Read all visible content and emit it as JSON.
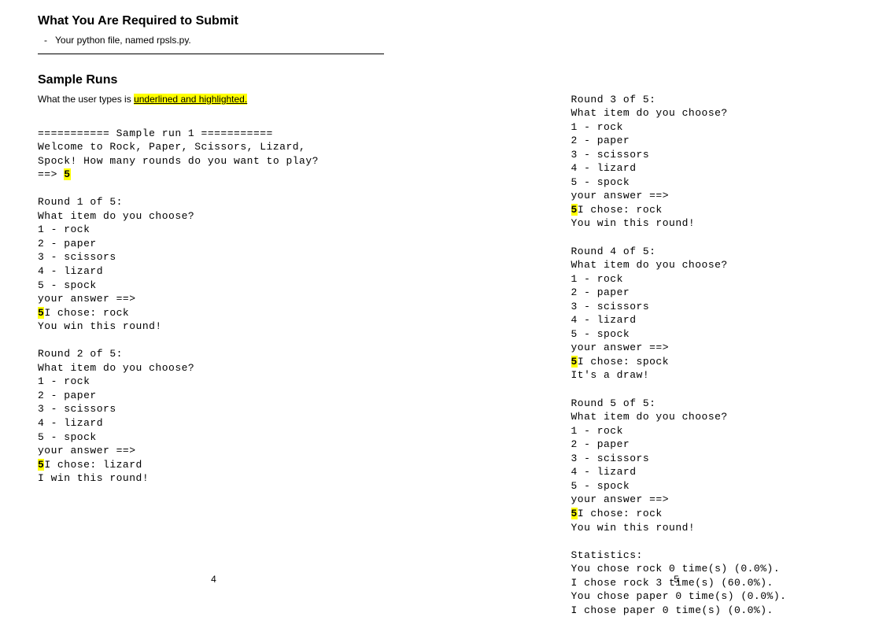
{
  "left": {
    "heading_submit": "What You Are Required to Submit",
    "bullet": "Your python file, named rpsls.py.",
    "heading_runs": "Sample Runs",
    "intro_pre": "What the user types is ",
    "intro_hl": "underlined and highlighted.",
    "run_header": "=========== Sample run 1 ===========",
    "welcome1": "Welcome to Rock, Paper, Scissors, Lizard,",
    "welcome2": "Spock! How many rounds do you want to play?",
    "prompt_top": "==> ",
    "input_top": "5",
    "round1": {
      "title": "Round 1 of 5:",
      "q": "What item do you choose?",
      "opts": [
        "1 - rock",
        "2 - paper",
        "3 - scissors",
        "4 - lizard",
        "5 - spock"
      ],
      "prompt": "your answer ==>",
      "input": "5",
      "chose": "I chose: rock",
      "result": "You win this round!"
    },
    "round2": {
      "title": "Round 2 of 5:",
      "q": "What item do you choose?",
      "opts": [
        "1 - rock",
        "2 - paper",
        "3 - scissors",
        "4 - lizard",
        "5 - spock"
      ],
      "prompt": "your answer ==>",
      "input": "5",
      "chose": "I chose: lizard",
      "result": "I win this round!"
    },
    "page_num": "4"
  },
  "right": {
    "round3": {
      "title": "Round 3 of 5:",
      "q": "What item do you choose?",
      "opts": [
        "1 - rock",
        "2 - paper",
        "3 - scissors",
        "4 - lizard",
        "5 - spock"
      ],
      "prompt": "your answer ==>",
      "input": "5",
      "chose": "I chose: rock",
      "result": "You win this round!"
    },
    "round4": {
      "title": "Round 4 of 5:",
      "q": "What item do you choose?",
      "opts": [
        "1 - rock",
        "2 - paper",
        "3 - scissors",
        "4 - lizard",
        "5 - spock"
      ],
      "prompt": "your answer ==>",
      "input": "5",
      "chose": "I chose: spock",
      "result": "It's a draw!"
    },
    "round5": {
      "title": "Round 5 of 5:",
      "q": "What item do you choose?",
      "opts": [
        "1 - rock",
        "2 - paper",
        "3 - scissors",
        "4 - lizard",
        "5 - spock"
      ],
      "prompt": "your answer ==>",
      "input": "5",
      "chose": "I chose: rock",
      "result": "You win this round!"
    },
    "stats": {
      "title": "Statistics:",
      "lines": [
        "You chose rock 0 time(s) (0.0%).",
        "I chose rock 3 time(s) (60.0%).",
        "You chose paper 0 time(s) (0.0%).",
        "I chose paper 0 time(s) (0.0%)."
      ]
    },
    "page_num": "5"
  }
}
